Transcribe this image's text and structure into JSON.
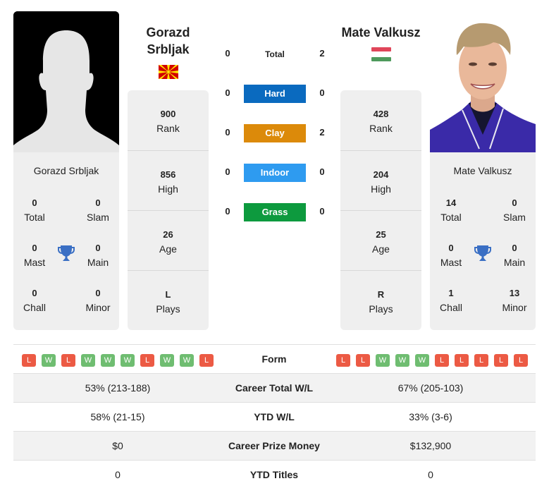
{
  "player_left": {
    "name": "Gorazd Srbljak",
    "name_line1": "Gorazd",
    "name_line2": "Srbljak",
    "country_flag": "north-macedonia-flag",
    "rank": "900",
    "rank_label": "Rank",
    "high": "856",
    "high_label": "High",
    "age": "26",
    "age_label": "Age",
    "plays": "L",
    "plays_label": "Plays",
    "titles": {
      "total": "0",
      "total_label": "Total",
      "slam": "0",
      "slam_label": "Slam",
      "mast": "0",
      "mast_label": "Mast",
      "main": "0",
      "main_label": "Main",
      "chall": "0",
      "chall_label": "Chall",
      "minor": "0",
      "minor_label": "Minor"
    },
    "form": [
      "L",
      "W",
      "L",
      "W",
      "W",
      "W",
      "L",
      "W",
      "W",
      "L"
    ]
  },
  "player_right": {
    "name": "Mate Valkusz",
    "country_flag": "hungary-flag",
    "rank": "428",
    "rank_label": "Rank",
    "high": "204",
    "high_label": "High",
    "age": "25",
    "age_label": "Age",
    "plays": "R",
    "plays_label": "Plays",
    "titles": {
      "total": "14",
      "total_label": "Total",
      "slam": "0",
      "slam_label": "Slam",
      "mast": "0",
      "mast_label": "Mast",
      "main": "0",
      "main_label": "Main",
      "chall": "1",
      "chall_label": "Chall",
      "minor": "13",
      "minor_label": "Minor"
    },
    "form": [
      "L",
      "L",
      "W",
      "W",
      "W",
      "L",
      "L",
      "L",
      "L",
      "L"
    ]
  },
  "h2h": {
    "total": {
      "label": "Total",
      "left": "0",
      "right": "2"
    },
    "surfaces": [
      {
        "label": "Hard",
        "left": "0",
        "right": "0",
        "color": "#0a6abf"
      },
      {
        "label": "Clay",
        "left": "0",
        "right": "2",
        "color": "#dc8a0a"
      },
      {
        "label": "Indoor",
        "left": "0",
        "right": "0",
        "color": "#2e9bf0"
      },
      {
        "label": "Grass",
        "left": "0",
        "right": "0",
        "color": "#0d9a3e"
      }
    ]
  },
  "form_label": "Form",
  "stats": [
    {
      "label": "Career Total W/L",
      "left": "53% (213-188)",
      "right": "67% (205-103)"
    },
    {
      "label": "YTD W/L",
      "left": "58% (21-15)",
      "right": "33% (3-6)"
    },
    {
      "label": "Career Prize Money",
      "left": "$0",
      "right": "$132,900"
    },
    {
      "label": "YTD Titles",
      "left": "0",
      "right": "0"
    }
  ],
  "colors": {
    "loss": "#ec5a44",
    "win": "#6fbd71",
    "trophy": "#3a6fc4",
    "card_bg": "#efefef"
  }
}
